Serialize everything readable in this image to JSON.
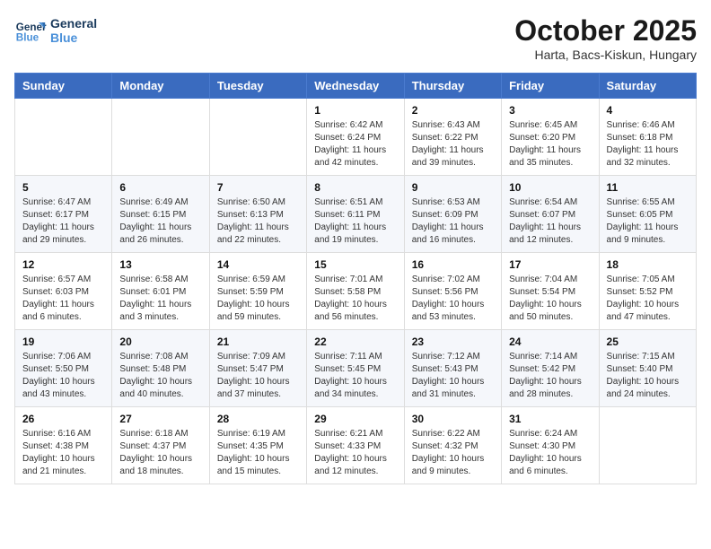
{
  "header": {
    "logo_line1": "General",
    "logo_line2": "Blue",
    "month": "October 2025",
    "location": "Harta, Bacs-Kiskun, Hungary"
  },
  "weekdays": [
    "Sunday",
    "Monday",
    "Tuesday",
    "Wednesday",
    "Thursday",
    "Friday",
    "Saturday"
  ],
  "weeks": [
    [
      {
        "day": "",
        "info": ""
      },
      {
        "day": "",
        "info": ""
      },
      {
        "day": "",
        "info": ""
      },
      {
        "day": "1",
        "info": "Sunrise: 6:42 AM\nSunset: 6:24 PM\nDaylight: 11 hours\nand 42 minutes."
      },
      {
        "day": "2",
        "info": "Sunrise: 6:43 AM\nSunset: 6:22 PM\nDaylight: 11 hours\nand 39 minutes."
      },
      {
        "day": "3",
        "info": "Sunrise: 6:45 AM\nSunset: 6:20 PM\nDaylight: 11 hours\nand 35 minutes."
      },
      {
        "day": "4",
        "info": "Sunrise: 6:46 AM\nSunset: 6:18 PM\nDaylight: 11 hours\nand 32 minutes."
      }
    ],
    [
      {
        "day": "5",
        "info": "Sunrise: 6:47 AM\nSunset: 6:17 PM\nDaylight: 11 hours\nand 29 minutes."
      },
      {
        "day": "6",
        "info": "Sunrise: 6:49 AM\nSunset: 6:15 PM\nDaylight: 11 hours\nand 26 minutes."
      },
      {
        "day": "7",
        "info": "Sunrise: 6:50 AM\nSunset: 6:13 PM\nDaylight: 11 hours\nand 22 minutes."
      },
      {
        "day": "8",
        "info": "Sunrise: 6:51 AM\nSunset: 6:11 PM\nDaylight: 11 hours\nand 19 minutes."
      },
      {
        "day": "9",
        "info": "Sunrise: 6:53 AM\nSunset: 6:09 PM\nDaylight: 11 hours\nand 16 minutes."
      },
      {
        "day": "10",
        "info": "Sunrise: 6:54 AM\nSunset: 6:07 PM\nDaylight: 11 hours\nand 12 minutes."
      },
      {
        "day": "11",
        "info": "Sunrise: 6:55 AM\nSunset: 6:05 PM\nDaylight: 11 hours\nand 9 minutes."
      }
    ],
    [
      {
        "day": "12",
        "info": "Sunrise: 6:57 AM\nSunset: 6:03 PM\nDaylight: 11 hours\nand 6 minutes."
      },
      {
        "day": "13",
        "info": "Sunrise: 6:58 AM\nSunset: 6:01 PM\nDaylight: 11 hours\nand 3 minutes."
      },
      {
        "day": "14",
        "info": "Sunrise: 6:59 AM\nSunset: 5:59 PM\nDaylight: 10 hours\nand 59 minutes."
      },
      {
        "day": "15",
        "info": "Sunrise: 7:01 AM\nSunset: 5:58 PM\nDaylight: 10 hours\nand 56 minutes."
      },
      {
        "day": "16",
        "info": "Sunrise: 7:02 AM\nSunset: 5:56 PM\nDaylight: 10 hours\nand 53 minutes."
      },
      {
        "day": "17",
        "info": "Sunrise: 7:04 AM\nSunset: 5:54 PM\nDaylight: 10 hours\nand 50 minutes."
      },
      {
        "day": "18",
        "info": "Sunrise: 7:05 AM\nSunset: 5:52 PM\nDaylight: 10 hours\nand 47 minutes."
      }
    ],
    [
      {
        "day": "19",
        "info": "Sunrise: 7:06 AM\nSunset: 5:50 PM\nDaylight: 10 hours\nand 43 minutes."
      },
      {
        "day": "20",
        "info": "Sunrise: 7:08 AM\nSunset: 5:48 PM\nDaylight: 10 hours\nand 40 minutes."
      },
      {
        "day": "21",
        "info": "Sunrise: 7:09 AM\nSunset: 5:47 PM\nDaylight: 10 hours\nand 37 minutes."
      },
      {
        "day": "22",
        "info": "Sunrise: 7:11 AM\nSunset: 5:45 PM\nDaylight: 10 hours\nand 34 minutes."
      },
      {
        "day": "23",
        "info": "Sunrise: 7:12 AM\nSunset: 5:43 PM\nDaylight: 10 hours\nand 31 minutes."
      },
      {
        "day": "24",
        "info": "Sunrise: 7:14 AM\nSunset: 5:42 PM\nDaylight: 10 hours\nand 28 minutes."
      },
      {
        "day": "25",
        "info": "Sunrise: 7:15 AM\nSunset: 5:40 PM\nDaylight: 10 hours\nand 24 minutes."
      }
    ],
    [
      {
        "day": "26",
        "info": "Sunrise: 6:16 AM\nSunset: 4:38 PM\nDaylight: 10 hours\nand 21 minutes."
      },
      {
        "day": "27",
        "info": "Sunrise: 6:18 AM\nSunset: 4:37 PM\nDaylight: 10 hours\nand 18 minutes."
      },
      {
        "day": "28",
        "info": "Sunrise: 6:19 AM\nSunset: 4:35 PM\nDaylight: 10 hours\nand 15 minutes."
      },
      {
        "day": "29",
        "info": "Sunrise: 6:21 AM\nSunset: 4:33 PM\nDaylight: 10 hours\nand 12 minutes."
      },
      {
        "day": "30",
        "info": "Sunrise: 6:22 AM\nSunset: 4:32 PM\nDaylight: 10 hours\nand 9 minutes."
      },
      {
        "day": "31",
        "info": "Sunrise: 6:24 AM\nSunset: 4:30 PM\nDaylight: 10 hours\nand 6 minutes."
      },
      {
        "day": "",
        "info": ""
      }
    ]
  ]
}
